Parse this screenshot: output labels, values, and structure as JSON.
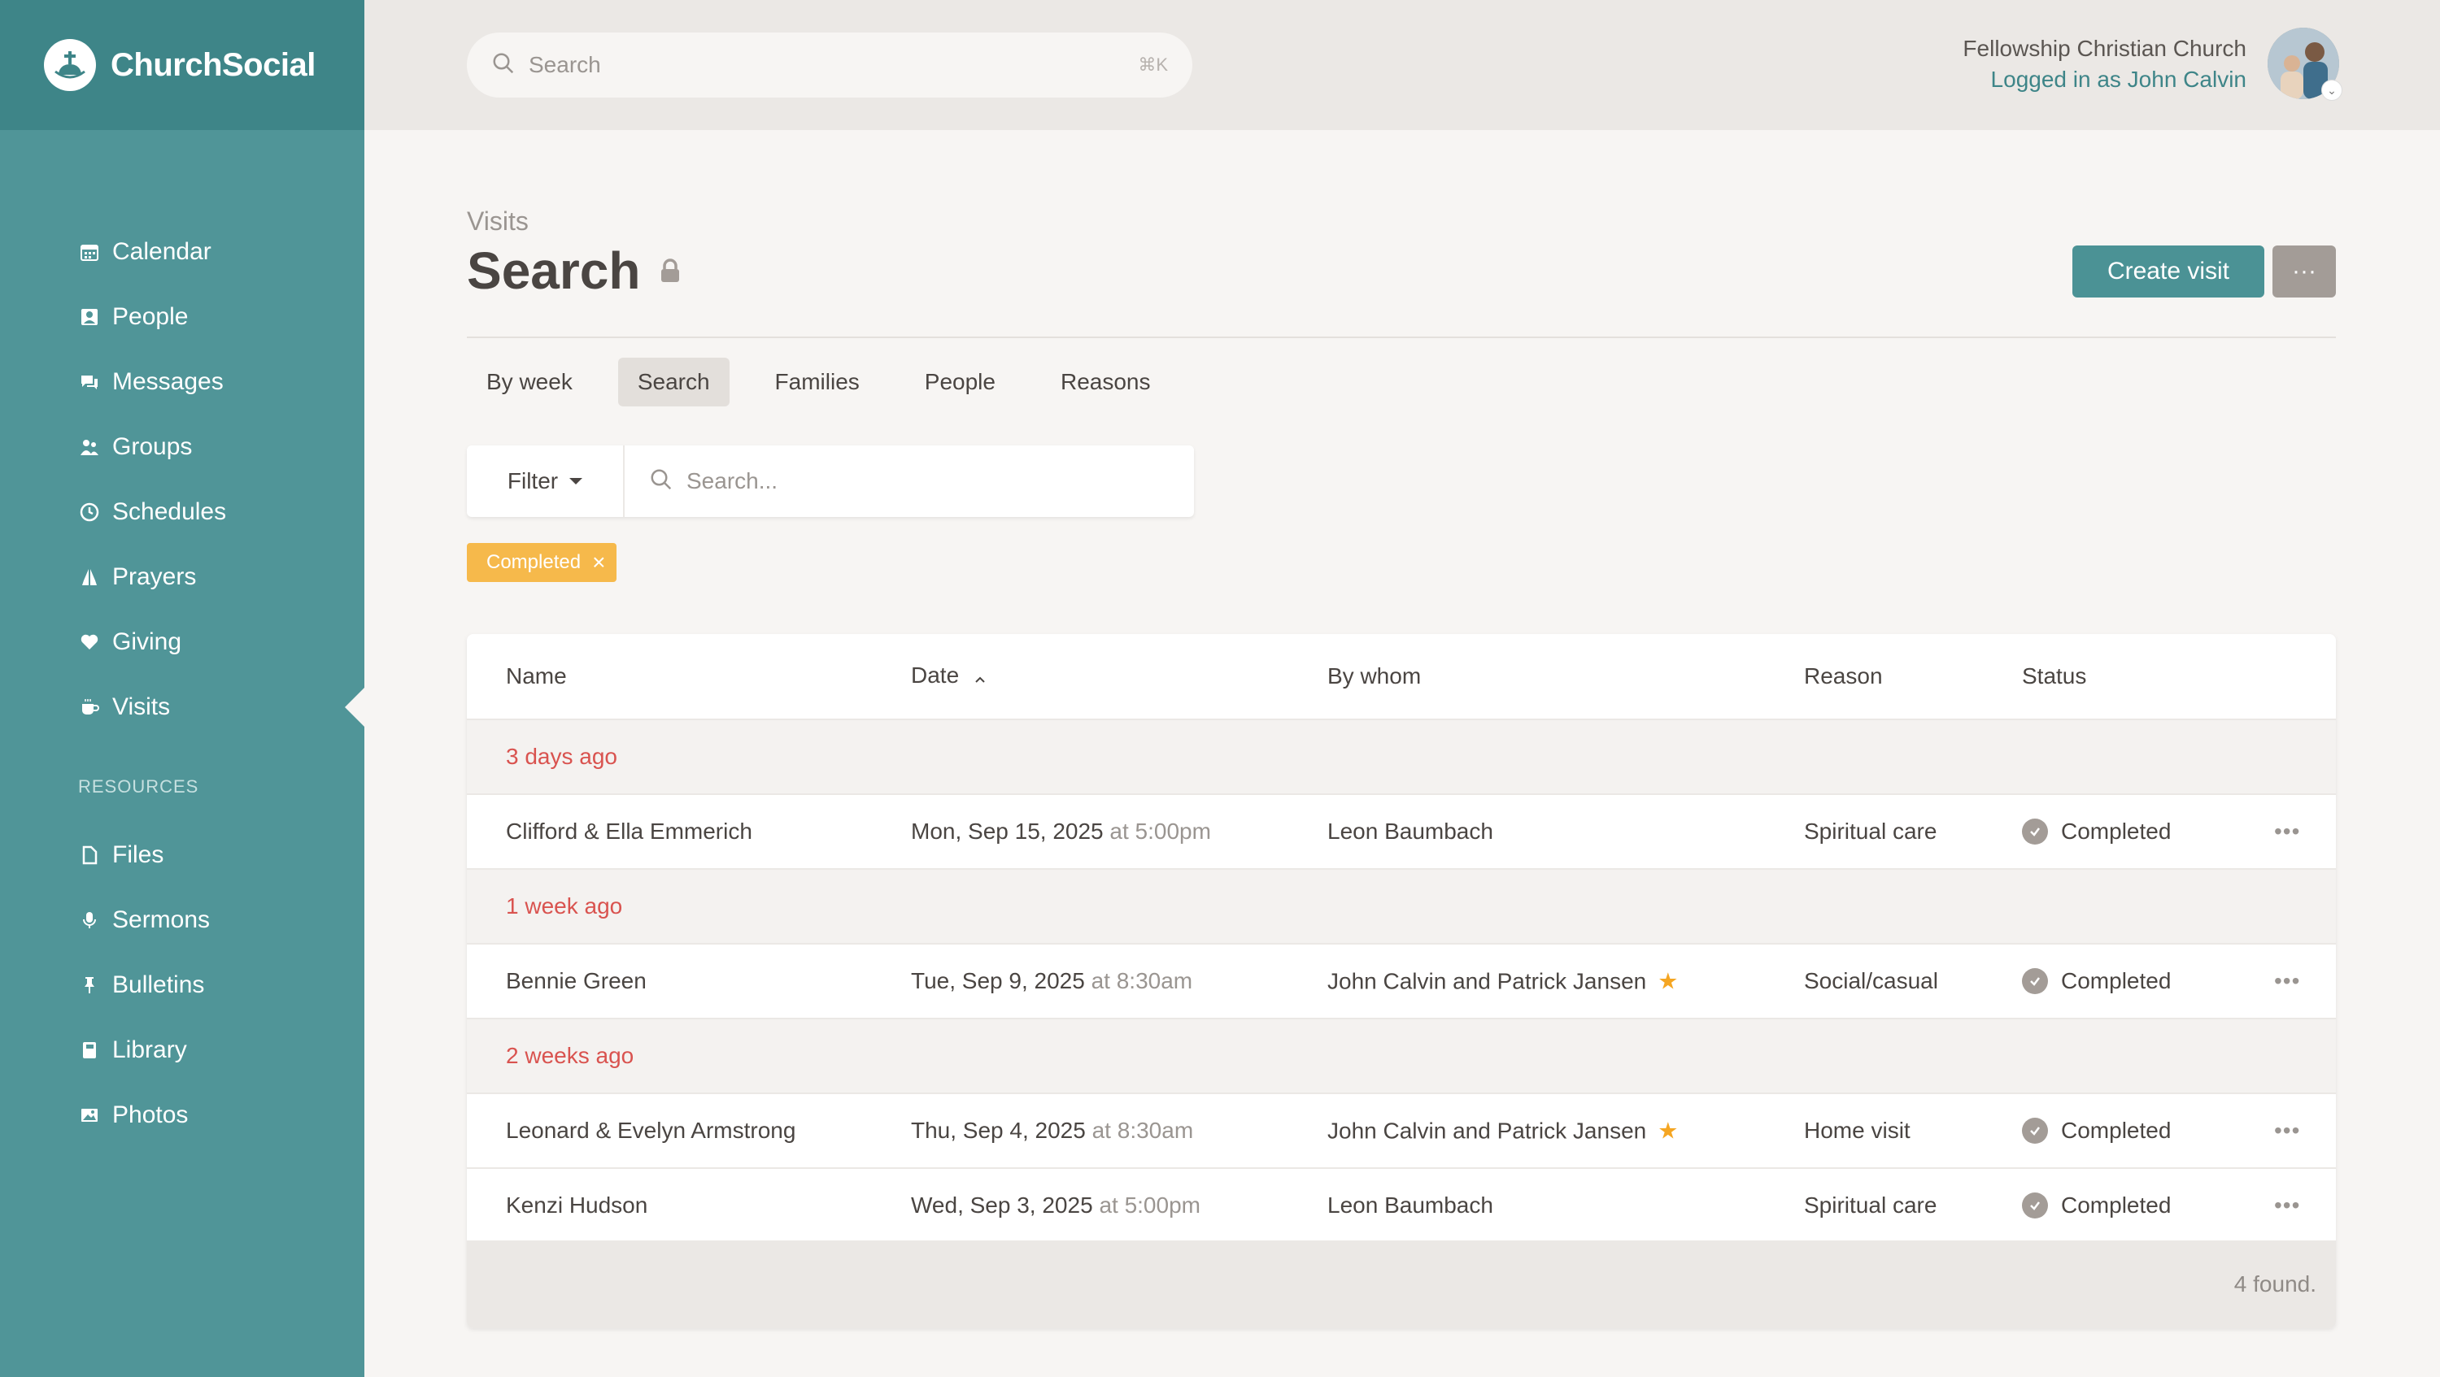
{
  "brand": {
    "name": "ChurchSocial"
  },
  "sidebar": {
    "items": [
      {
        "label": "Calendar",
        "icon": "calendar-icon"
      },
      {
        "label": "People",
        "icon": "people-icon"
      },
      {
        "label": "Messages",
        "icon": "messages-icon"
      },
      {
        "label": "Groups",
        "icon": "groups-icon"
      },
      {
        "label": "Schedules",
        "icon": "clock-icon"
      },
      {
        "label": "Prayers",
        "icon": "praying-hands-icon"
      },
      {
        "label": "Giving",
        "icon": "heart-icon"
      },
      {
        "label": "Visits",
        "icon": "coffee-cup-icon",
        "active": true
      }
    ],
    "resources_label": "RESOURCES",
    "resources": [
      {
        "label": "Files",
        "icon": "file-icon"
      },
      {
        "label": "Sermons",
        "icon": "microphone-icon"
      },
      {
        "label": "Bulletins",
        "icon": "pin-icon"
      },
      {
        "label": "Library",
        "icon": "book-icon"
      },
      {
        "label": "Photos",
        "icon": "image-icon"
      }
    ]
  },
  "topbar": {
    "search_placeholder": "Search",
    "shortcut": "⌘K",
    "org_name": "Fellowship Christian Church",
    "user_line": "Logged in as John Calvin"
  },
  "page": {
    "breadcrumb": "Visits",
    "title": "Search",
    "create_button": "Create visit",
    "more_button": "···"
  },
  "tabs": [
    {
      "label": "By week"
    },
    {
      "label": "Search",
      "active": true
    },
    {
      "label": "Families"
    },
    {
      "label": "People"
    },
    {
      "label": "Reasons"
    }
  ],
  "filter": {
    "button_label": "Filter",
    "search_placeholder": "Search...",
    "chip_label": "Completed",
    "chip_color": "#f6b94b"
  },
  "table": {
    "headers": {
      "name": "Name",
      "date": "Date",
      "by": "By whom",
      "reason": "Reason",
      "status": "Status"
    },
    "groups": [
      {
        "label": "3 days ago",
        "rows": [
          {
            "name": "Clifford & Ella Emmerich",
            "date": "Mon, Sep 15, 2025",
            "at": "at",
            "time": "5:00pm",
            "by": "Leon Baumbach",
            "star": false,
            "reason": "Spiritual care",
            "status": "Completed"
          }
        ]
      },
      {
        "label": "1 week ago",
        "rows": [
          {
            "name": "Bennie Green",
            "date": "Tue, Sep 9, 2025",
            "at": "at",
            "time": "8:30am",
            "by": "John Calvin and Patrick Jansen",
            "star": true,
            "reason": "Social/casual",
            "status": "Completed"
          }
        ]
      },
      {
        "label": "2 weeks ago",
        "rows": [
          {
            "name": "Leonard & Evelyn Armstrong",
            "date": "Thu, Sep 4, 2025",
            "at": "at",
            "time": "8:30am",
            "by": "John Calvin and Patrick Jansen",
            "star": true,
            "reason": "Home visit",
            "status": "Completed"
          },
          {
            "name": "Kenzi Hudson",
            "date": "Wed, Sep 3, 2025",
            "at": "at",
            "time": "5:00pm",
            "by": "Leon Baumbach",
            "star": false,
            "reason": "Spiritual care",
            "status": "Completed"
          }
        ]
      }
    ],
    "footer": "4 found."
  },
  "colors": {
    "teal": "#509598",
    "brand_bg": "#3e8588",
    "primary": "#4b9295",
    "group_label": "#d9534f",
    "star": "#f5a623"
  }
}
